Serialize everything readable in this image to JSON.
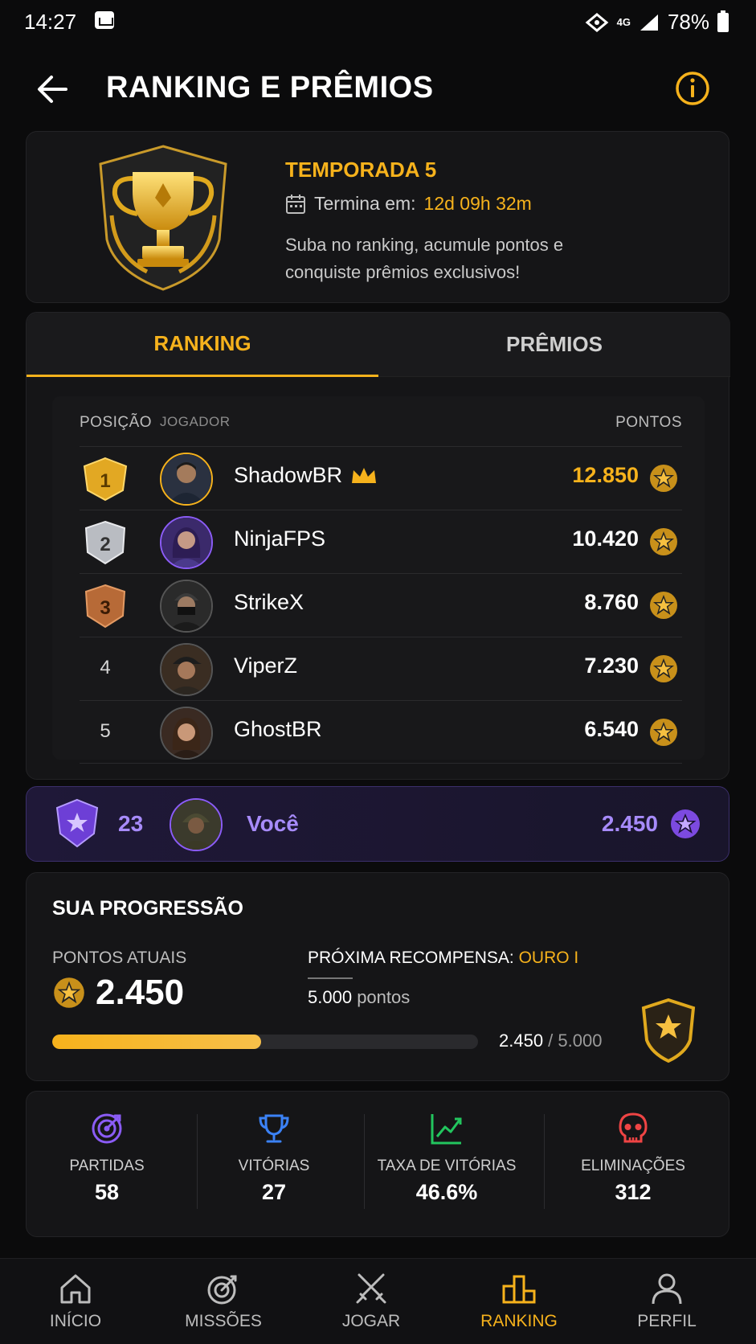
{
  "status_bar": {
    "time": "14:27",
    "network": "4G",
    "battery": "78%"
  },
  "header": {
    "title": "RANKING E PRÊMIOS"
  },
  "season": {
    "title": "TEMPORADA 5",
    "ends_label": "Termina em:",
    "ends_value": "12d 09h 32m",
    "description": "Suba no ranking, acumule pontos e conquiste prêmios exclusivos!"
  },
  "tabs": [
    {
      "label": "RANKING",
      "active": true
    },
    {
      "label": "PRÊMIOS",
      "active": false
    }
  ],
  "ranking": {
    "columns": {
      "position": "POSIÇÃO",
      "player": "JOGADOR",
      "points": "PONTOS"
    },
    "rows": [
      {
        "rank": "1",
        "name": "ShadowBR",
        "points": "12.850",
        "crown": true
      },
      {
        "rank": "2",
        "name": "NinjaFPS",
        "points": "10.420"
      },
      {
        "rank": "3",
        "name": "StrikeX",
        "points": "8.760"
      },
      {
        "rank": "4",
        "name": "ViperZ",
        "points": "7.230"
      },
      {
        "rank": "5",
        "name": "GhostBR",
        "points": "6.540"
      }
    ]
  },
  "you": {
    "rank": "23",
    "name": "Você",
    "points": "2.450"
  },
  "progress": {
    "title": "SUA PROGRESSÃO",
    "current_label": "PONTOS ATUAIS",
    "current_value": "2.450",
    "next_label": "PRÓXIMA RECOMPENSA:",
    "next_reward": "OURO I",
    "next_points": "5.000",
    "next_points_unit": "pontos",
    "bar_current": "2.450",
    "bar_sep": " / ",
    "bar_target": "5.000",
    "fraction": 0.49
  },
  "stats": [
    {
      "label": "PARTIDAS",
      "value": "58",
      "icon": "target-icon",
      "color": "#8b5cf6"
    },
    {
      "label": "VITÓRIAS",
      "value": "27",
      "icon": "trophy-icon",
      "color": "#3b82f6"
    },
    {
      "label": "TAXA DE VITÓRIAS",
      "value": "46.6%",
      "icon": "trend-up-icon",
      "color": "#22c55e"
    },
    {
      "label": "ELIMINAÇÕES",
      "value": "312",
      "icon": "skull-icon",
      "color": "#ef4444"
    }
  ],
  "nav": [
    {
      "label": "INÍCIO",
      "icon": "home-icon"
    },
    {
      "label": "MISSÕES",
      "icon": "missions-icon"
    },
    {
      "label": "JOGAR",
      "icon": "swords-icon"
    },
    {
      "label": "RANKING",
      "icon": "podium-icon",
      "active": true
    },
    {
      "label": "PERFIL",
      "icon": "user-icon"
    }
  ],
  "colors": {
    "accent": "#f6b21c",
    "purple": "#a78bfa",
    "background": "#0b0b0c"
  }
}
